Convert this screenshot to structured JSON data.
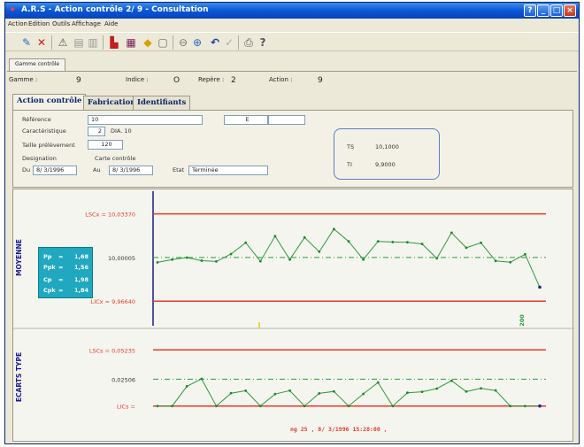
{
  "window": {
    "title": "A.R.S - Action contrôle  2/  9   - Consultation",
    "controls": [
      "?",
      "_",
      "□",
      "×"
    ]
  },
  "menu": [
    "Action",
    "Edition",
    "Outils",
    "Affichage",
    "Aide"
  ],
  "toolbar": {
    "icons": [
      "edit-icon",
      "delete-icon",
      "warning-icon",
      "doc-icon",
      "doc2-icon",
      "chart-bar-icon",
      "histogram-icon",
      "diamond-icon",
      "file-icon",
      "zoom-icon",
      "search-icon",
      "undo-icon",
      "check-icon",
      "print-icon",
      "help-icon"
    ],
    "help_glyph": "?"
  },
  "outer_tab": "Gamme contrôle",
  "header": {
    "gamme_label": "Gamme :",
    "gamme_value": "9",
    "indice_label": "Indice :",
    "indice_value": "O",
    "repere_label": "Repère :",
    "repere_value": "2",
    "action_label": "Action :",
    "action_value": "9"
  },
  "tabs": [
    {
      "label": "Action contrôle",
      "active": true
    },
    {
      "label": "Fabrication",
      "active": false
    },
    {
      "label": "Identifiants",
      "active": false
    }
  ],
  "form": {
    "reference_label": "Référence",
    "reference_value": "10",
    "ref_extra_value": "E",
    "caracteristique_label": "Caractéristique",
    "caracteristique_num": "2",
    "caracteristique_value": "DIA. 10",
    "taille_label": "Taille prélèvement",
    "taille_value": "120",
    "designation_label": "Designation",
    "designation_value": "Carte contrôle",
    "du_label": "Du",
    "du_value": "8/ 3/1996",
    "au_label": "Au",
    "au_value": "8/ 3/1996",
    "etat_label": "Etat",
    "etat_value": "Terminée",
    "ts_label": "TS",
    "ts_value": "10,1000",
    "ti_label": "TI",
    "ti_value": "9,9000"
  },
  "stats": {
    "pp_label": "Pp",
    "pp_value": "1,68",
    "ppk_label": "Ppk",
    "ppk_value": "1,56",
    "cp_label": "Cp",
    "cp_value": "1,98",
    "cpk_label": "Cpk",
    "cpk_value": "1,84",
    "eq": "="
  },
  "colors": {
    "limit": "#e8392c",
    "mean": "#2c9a3c",
    "marker": "#1a8a2a",
    "axis": "#1a1a8a",
    "stats_bg": "#1fa8c0",
    "footer": "#e8392c"
  },
  "chart_data": [
    {
      "type": "line",
      "ylabel": "MOYENNE",
      "ucl_label": "LSCx = 10,03370",
      "center_label": "10,00005",
      "lcl_label": "LICx = 9,96640",
      "ucl": 10.0337,
      "center": 10.00005,
      "lcl": 9.9664,
      "ylim": [
        9.957,
        10.043
      ],
      "x_marker_label": "200",
      "values": [
        9.9963,
        9.9985,
        10.0,
        9.9976,
        9.997,
        10.0027,
        10.0115,
        9.9972,
        10.0165,
        9.9985,
        10.0155,
        10.0045,
        10.022,
        10.0125,
        9.9985,
        10.0125,
        10.012,
        10.0118,
        10.0105,
        9.9994,
        10.0192,
        10.0076,
        10.0114,
        9.9974,
        9.9964,
        10.0025,
        9.9772
      ]
    },
    {
      "type": "line",
      "ylabel": "ECARTS TYPE",
      "ucl_label": "LSCs = 0,05235",
      "center_label": "0,02506",
      "lcl_label": "LICs =",
      "ucl": 0.05235,
      "center": 0.02506,
      "lcl": 0.0,
      "ylim": [
        -0.006,
        0.06
      ],
      "values": [
        0.0,
        0.0,
        0.0184,
        0.0253,
        0.0,
        0.012,
        0.0143,
        0.0,
        0.0112,
        0.0144,
        0.0,
        0.0118,
        0.0136,
        0.0,
        0.0113,
        0.0219,
        0.0,
        0.0124,
        0.0133,
        0.0163,
        0.0236,
        0.0135,
        0.0165,
        0.0145,
        0.0,
        0.0,
        0.0
      ],
      "footer": "ng   25 , 8/ 3/1996 15:28:00 ,"
    }
  ]
}
